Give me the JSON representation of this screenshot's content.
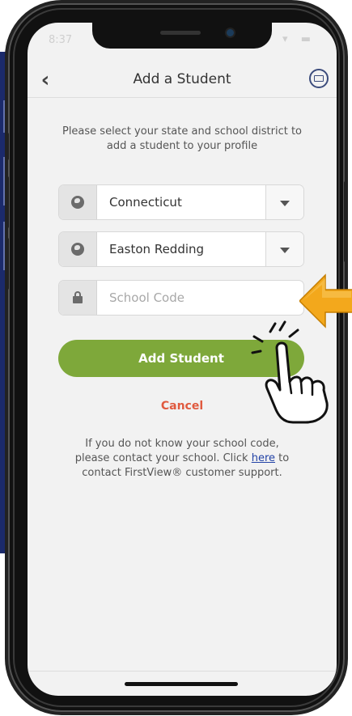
{
  "status_bar": {
    "time": "8:37",
    "icons": "◦ ▾ ▬"
  },
  "nav": {
    "title": "Add a Student",
    "back_icon": "chevron-left-icon",
    "mail_icon": "mail-icon"
  },
  "instructions": "Please select your state and school district to add a student to your profile",
  "form": {
    "state": {
      "value": "Connecticut",
      "icon": "globe-icon"
    },
    "district": {
      "value": "Easton Redding",
      "icon": "globe-icon"
    },
    "school_code": {
      "placeholder": "School Code",
      "icon": "lock-icon"
    }
  },
  "add_button": "Add Student",
  "cancel_link": "Cancel",
  "help": {
    "text_before": "If you do not know your school code, please contact your school. Click ",
    "link": "here",
    "text_after": " to contact FirstView® customer support."
  },
  "colors": {
    "primary_green": "#7ea83a",
    "cancel_red": "#e05a3f",
    "arrow_orange": "#f3a81c",
    "navy": "#1b2a6b"
  }
}
